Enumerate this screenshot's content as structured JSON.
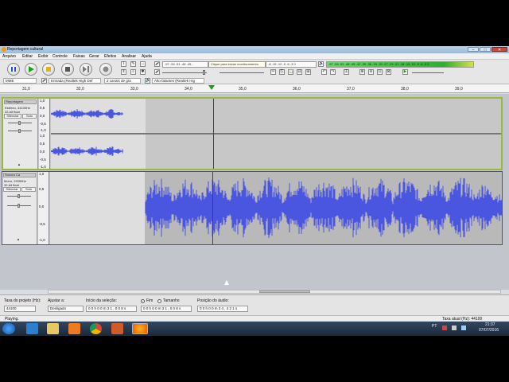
{
  "window": {
    "title": "Reportagem cultural",
    "controls": [
      "–",
      "□",
      "✕"
    ]
  },
  "menu": [
    "Arquivo",
    "Editar",
    "Exibir",
    "Controle",
    "Faixas",
    "Gerar",
    "Efeitos",
    "Analisar",
    "Ajuda"
  ],
  "toolbar": {
    "transport": [
      "pause",
      "play",
      "loop",
      "stop",
      "skip-start",
      "record"
    ],
    "record_meter": "-57 -54 -51 -48 -45 -",
    "record_meter_hint": "Clique para iniciar monitoramento",
    "record_meter_right": "-8 -15 -12 -9 -6 -3 0",
    "play_meter": "-57 -54 -51 -48 -45 -42 -39 -36 -33 -30 -27 -24 -21 -18 -15 -12 -9 -6 -3 0",
    "host": "MME",
    "input_device": "Entrada (Realtek High Def",
    "input_channels": "2 canais de gra",
    "output_device": "Alto-falantes (Realtek Hig"
  },
  "ruler": {
    "ticks": [
      "31,0",
      "32,0",
      "33,0",
      "34,0",
      "35,0",
      "36,0",
      "37,0",
      "38,0",
      "39,0"
    ]
  },
  "tracks": [
    {
      "name": "Reportagem",
      "info": [
        "Estéreo, 44100Hz",
        "32-bit float"
      ],
      "mute_label": "Silenciar",
      "solo_label": "Solo",
      "scale": [
        "1,0",
        "0,5",
        "0,0",
        "-0,5",
        "-1,0",
        "1,0",
        "0,5",
        "0,0",
        "-0,5",
        "-1,0"
      ]
    },
    {
      "name": "Sonora Ca",
      "info": [
        "Mono, 22050Hz",
        "32-bit float"
      ],
      "mute_label": "Silenciar",
      "solo_label": "Solo",
      "scale": [
        "1,0",
        "0,5",
        "0,0",
        "-0,5",
        "-1,0"
      ]
    }
  ],
  "selection_toolbar": {
    "project_rate_label": "Taxa do projeto (Hz):",
    "project_rate": "44100",
    "snap_label": "Ajustar a:",
    "snap_value": "Desligado",
    "sel_start_label": "Início da seleção:",
    "sel_start": "0 0 h 0 0 m 3 1 , 0 0 8 s",
    "end_label": "Fim",
    "length_label": "Tamanho",
    "sel_end": "0 0 h 0 0 m 3 1 , 0 0 8 s",
    "audio_pos_label": "Posição do áudio:",
    "audio_pos": "0 0 h 0 0 m 3 4 , 4 2 1 s"
  },
  "status": {
    "left": "Playing.",
    "right": "Taxa atual (Hz): 44100"
  },
  "taskbar": {
    "lang": "PT",
    "time": "21:37",
    "date": "07/07/2016"
  },
  "colors": {
    "wave": "#4a55e0",
    "wave_dark": "#3a3fa8",
    "play_green": "#1ea01e",
    "record_red": "#cc2222",
    "selection": "#dedede"
  }
}
